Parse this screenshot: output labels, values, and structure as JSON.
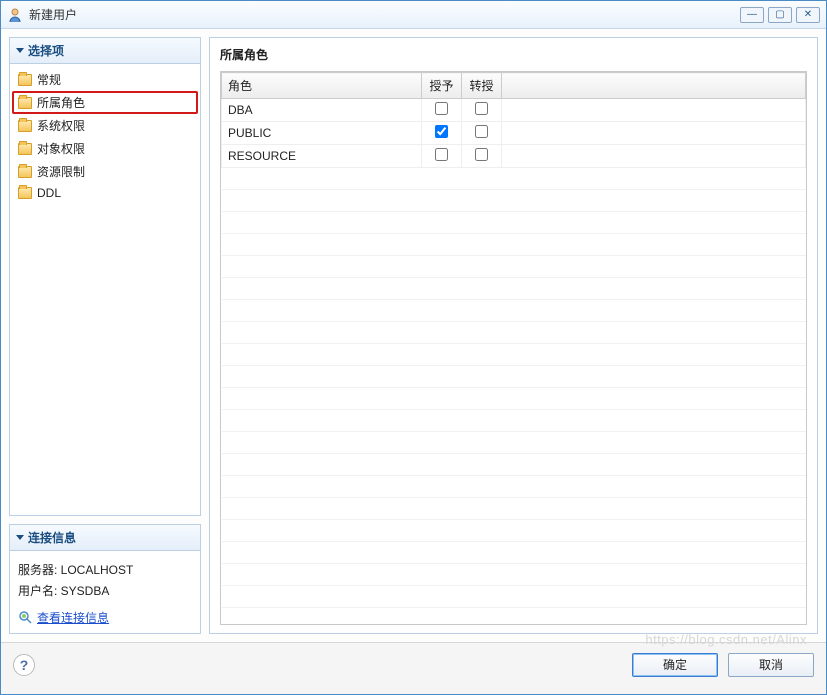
{
  "window": {
    "title": "新建用户"
  },
  "sidebar": {
    "options_header": "选择项",
    "items": [
      {
        "label": "常规"
      },
      {
        "label": "所属角色",
        "selected": true
      },
      {
        "label": "系统权限"
      },
      {
        "label": "对象权限"
      },
      {
        "label": "资源限制"
      },
      {
        "label": "DDL"
      }
    ],
    "connection_header": "连接信息",
    "server_line": "服务器: LOCALHOST",
    "user_line": "用户名: SYSDBA",
    "view_conn_label": "查看连接信息"
  },
  "main": {
    "title": "所属角色",
    "columns": {
      "role": "角色",
      "grant": "授予",
      "admin": "转授"
    },
    "rows": [
      {
        "role": "DBA",
        "grant": false,
        "admin": false
      },
      {
        "role": "PUBLIC",
        "grant": true,
        "admin": false
      },
      {
        "role": "RESOURCE",
        "grant": false,
        "admin": false
      }
    ]
  },
  "footer": {
    "ok": "确定",
    "cancel": "取消"
  },
  "watermark": "https://blog.csdn.net/Alinx"
}
